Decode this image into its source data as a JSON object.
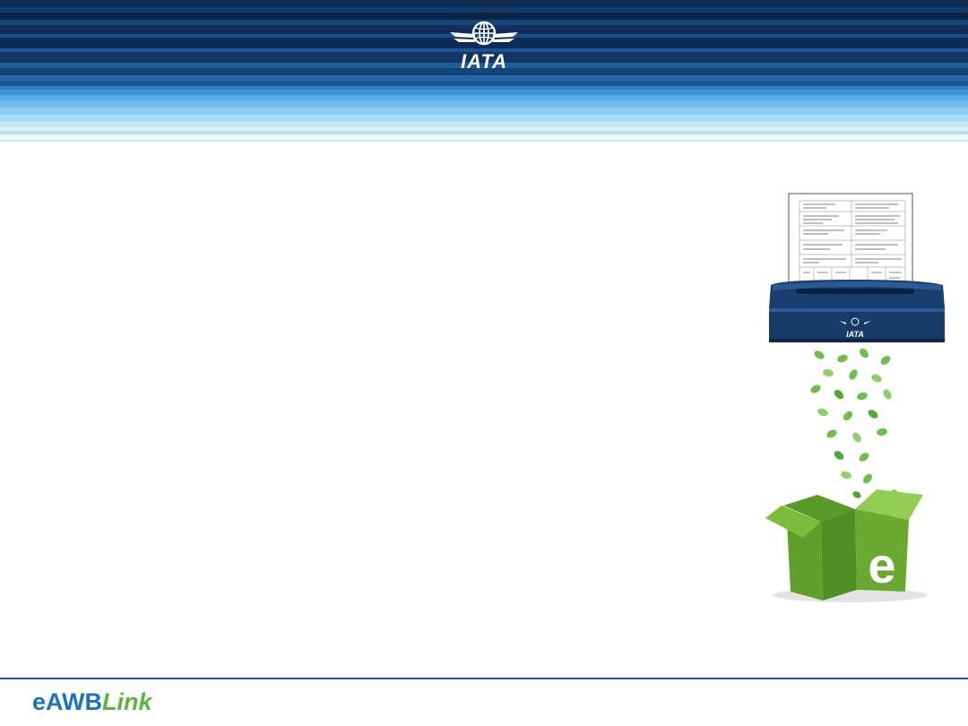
{
  "header": {
    "logo_text": "IATA"
  },
  "illustration": {
    "shredder_label": "IATA",
    "box_letter": "e"
  },
  "footer": {
    "brand_main": "eAWB",
    "brand_suffix": "Link"
  },
  "colors": {
    "header_dark": "#0d2a52",
    "header_light": "#8fccf4",
    "brand_blue": "#1a73c1",
    "brand_green": "#5bb543",
    "box_green": "#6aa832"
  }
}
